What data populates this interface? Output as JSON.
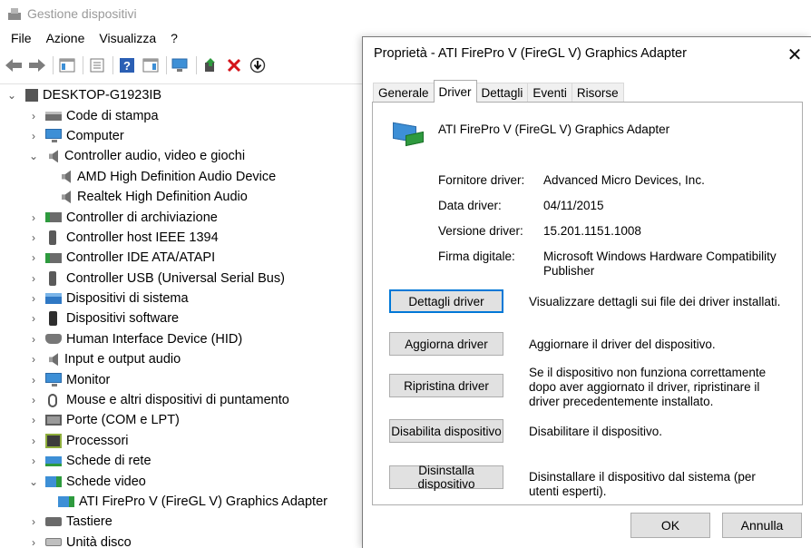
{
  "device_manager": {
    "title": "Gestione dispositivi",
    "menu": [
      "File",
      "Azione",
      "Visualizza",
      "?"
    ],
    "tree": {
      "root": "DESKTOP-G1923IB",
      "items": [
        {
          "label": "Code di stampa"
        },
        {
          "label": "Computer"
        },
        {
          "label": "Controller audio, video e giochi"
        },
        {
          "label": "AMD High Definition Audio Device"
        },
        {
          "label": "Realtek High Definition Audio"
        },
        {
          "label": "Controller di archiviazione"
        },
        {
          "label": "Controller host IEEE 1394"
        },
        {
          "label": "Controller IDE ATA/ATAPI"
        },
        {
          "label": "Controller USB (Universal Serial Bus)"
        },
        {
          "label": "Dispositivi di sistema"
        },
        {
          "label": "Dispositivi software"
        },
        {
          "label": "Human Interface Device (HID)"
        },
        {
          "label": "Input e output audio"
        },
        {
          "label": "Monitor"
        },
        {
          "label": "Mouse e altri dispositivi di puntamento"
        },
        {
          "label": "Porte (COM e LPT)"
        },
        {
          "label": "Processori"
        },
        {
          "label": "Schede di rete"
        },
        {
          "label": "Schede video"
        },
        {
          "label": "ATI FirePro V (FireGL V) Graphics Adapter"
        },
        {
          "label": "Tastiere"
        },
        {
          "label": "Unità disco"
        }
      ]
    }
  },
  "dialog": {
    "title": "Proprietà - ATI FirePro V (FireGL V) Graphics Adapter",
    "tabs": [
      "Generale",
      "Driver",
      "Dettagli",
      "Eventi",
      "Risorse"
    ],
    "active_tab": "Driver",
    "device_name": "ATI FirePro V (FireGL V) Graphics Adapter",
    "info": {
      "provider_label": "Fornitore driver:",
      "provider_value": "Advanced Micro Devices, Inc.",
      "date_label": "Data driver:",
      "date_value": "04/11/2015",
      "version_label": "Versione driver:",
      "version_value": "15.201.1151.1008",
      "signer_label": "Firma digitale:",
      "signer_value": "Microsoft Windows Hardware Compatibility Publisher"
    },
    "actions": {
      "details_button": "Dettagli driver",
      "details_desc": "Visualizzare dettagli sui file dei driver installati.",
      "update_button": "Aggiorna driver",
      "update_desc": "Aggiornare il driver del dispositivo.",
      "rollback_button": "Ripristina driver",
      "rollback_desc": "Se il dispositivo non funziona correttamente dopo aver aggiornato il driver, ripristinare il driver precedentemente installato.",
      "disable_button": "Disabilita dispositivo",
      "disable_desc": "Disabilitare il dispositivo.",
      "uninstall_button": "Disinstalla dispositivo",
      "uninstall_desc": "Disinstallare il dispositivo dal sistema (per utenti esperti)."
    },
    "ok_label": "OK",
    "cancel_label": "Annulla",
    "close_glyph": "✕"
  }
}
